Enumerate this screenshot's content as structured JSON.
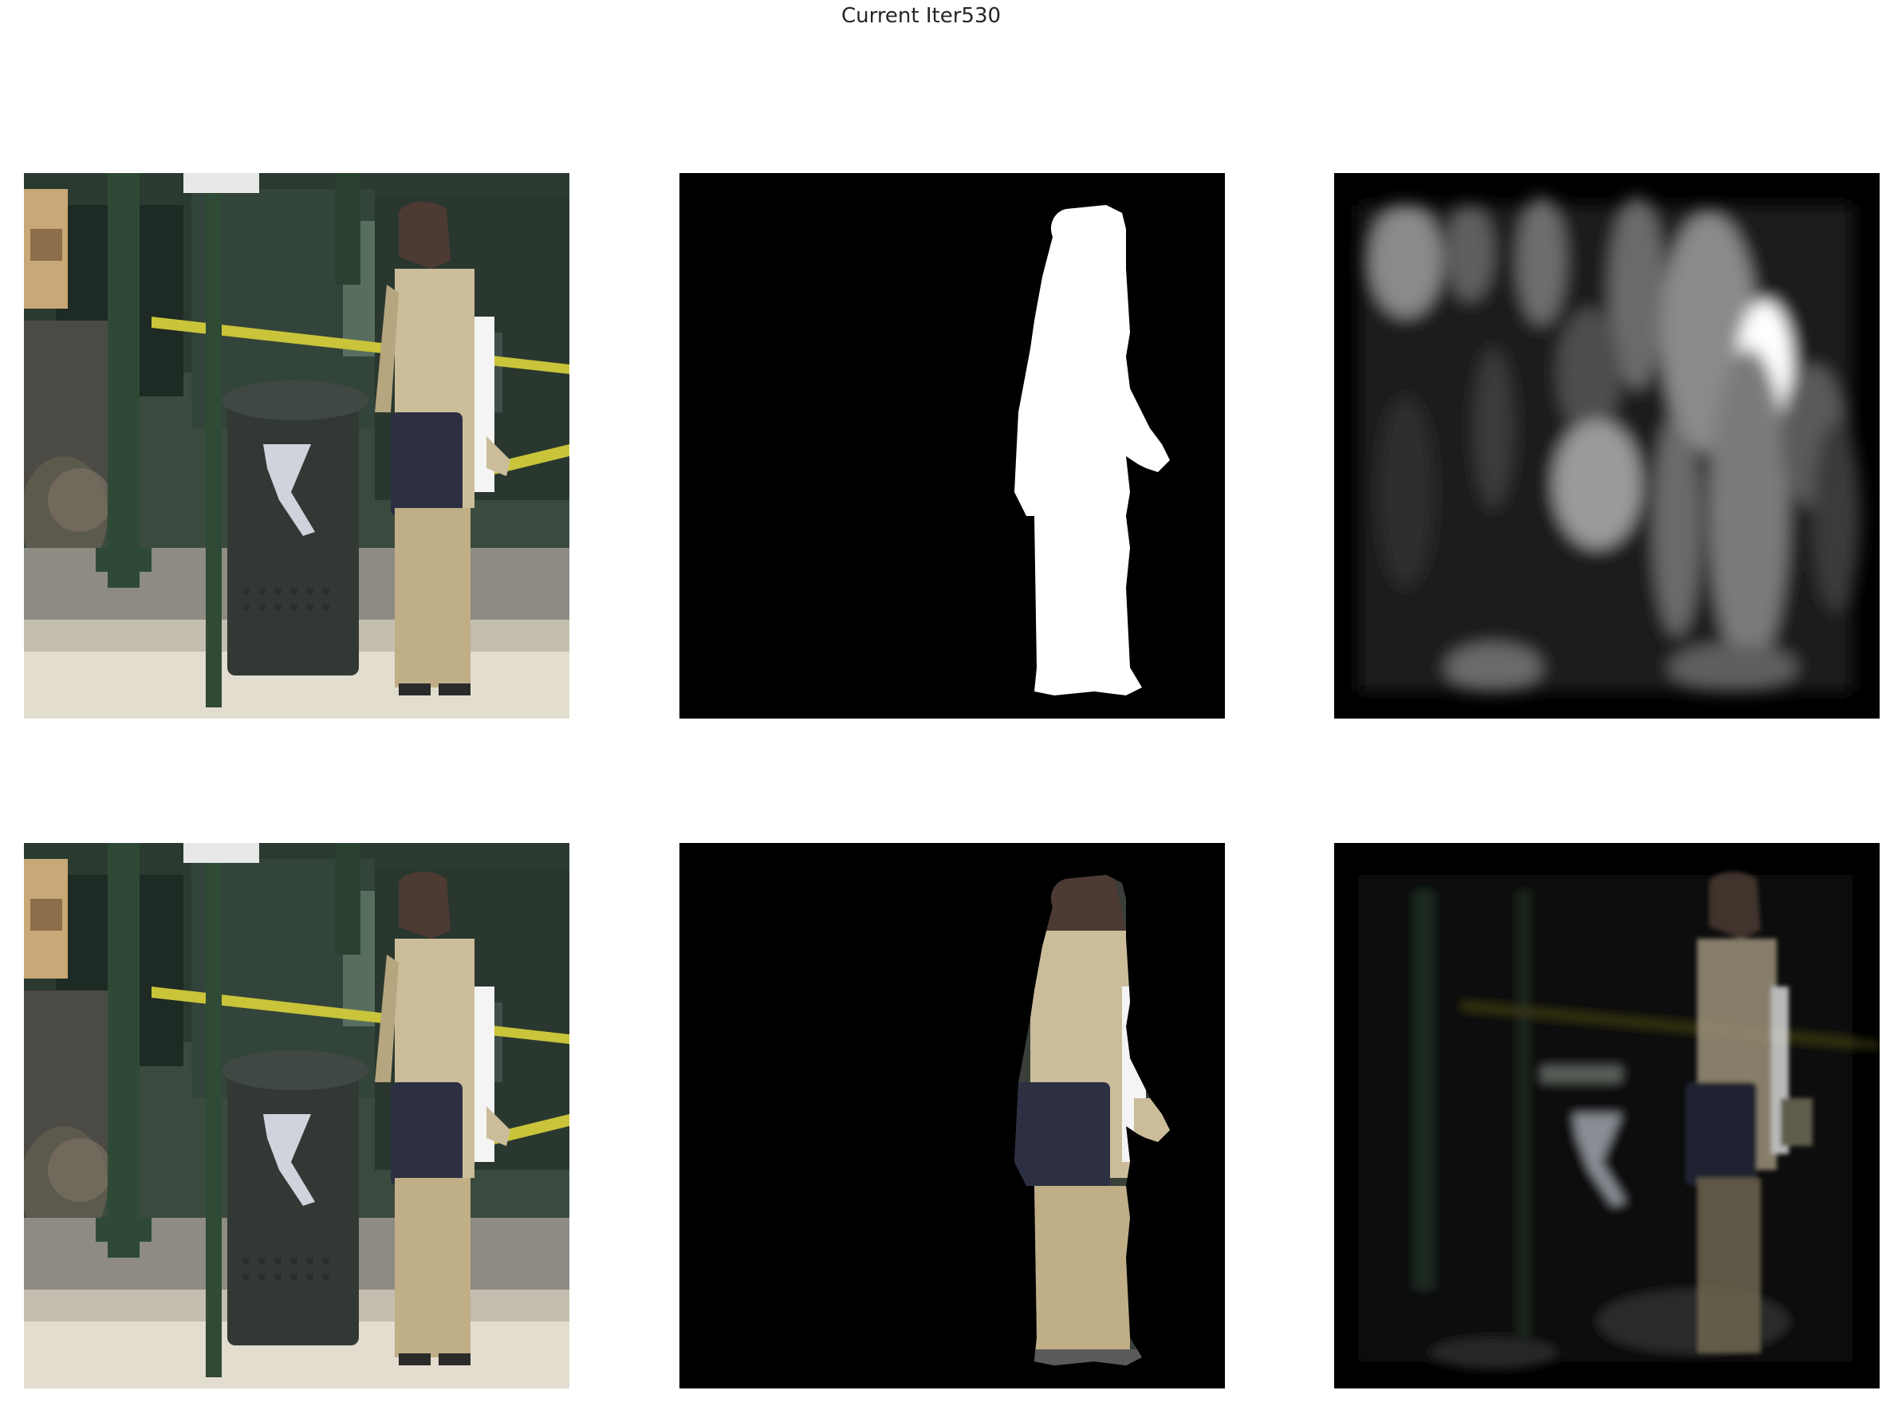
{
  "figure": {
    "title": "Current Iter530"
  },
  "panels": [
    {
      "row": 1,
      "col": 1,
      "content": "input-image"
    },
    {
      "row": 1,
      "col": 2,
      "content": "ground-truth-mask"
    },
    {
      "row": 1,
      "col": 3,
      "content": "predicted-mask"
    },
    {
      "row": 2,
      "col": 1,
      "content": "input-image"
    },
    {
      "row": 2,
      "col": 2,
      "content": "ground-truth-masked-image"
    },
    {
      "row": 2,
      "col": 3,
      "content": "predicted-masked-image"
    }
  ],
  "colors": {
    "background": "#ffffff",
    "mask_background": "#000000",
    "mask_foreground": "#ffffff",
    "pole": "#2f4a35",
    "coat": "#cbbd9a",
    "pants": "#bfae86",
    "bag": "#2c3042",
    "trash_can": "#323935",
    "caution_tape": "#c9c43a"
  }
}
